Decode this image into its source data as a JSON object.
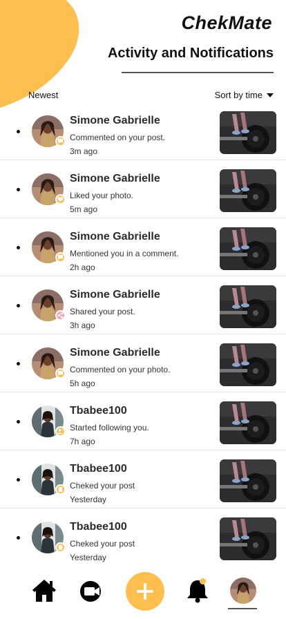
{
  "header": {
    "app_title": "ChekMate",
    "page_title": "Activity and Notifications"
  },
  "filter": {
    "label": "Newest",
    "sort_label": "Sort by time"
  },
  "colors": {
    "accent": "#fdbf50",
    "badge_pink": "#f5a3b8"
  },
  "notifications": [
    {
      "user": "Simone Gabrielle",
      "message": "Commented on your post.",
      "time": "3m ago",
      "badge_icon": "comment-icon",
      "avatar": "simone"
    },
    {
      "user": "Simone Gabrielle",
      "message": "Liked your photo.",
      "time": "5m ago",
      "badge_icon": "heart-icon",
      "avatar": "simone"
    },
    {
      "user": "Simone Gabrielle",
      "message": "Mentioned you in a comment.",
      "time": "2h ago",
      "badge_icon": "comment-icon",
      "avatar": "simone"
    },
    {
      "user": "Simone Gabrielle",
      "message": "Shared your post.",
      "time": "3h ago",
      "badge_icon": "share-icon",
      "avatar": "simone"
    },
    {
      "user": "Simone Gabrielle",
      "message": "Commented on your photo.",
      "time": "5h ago",
      "badge_icon": "comment-icon",
      "avatar": "simone"
    },
    {
      "user": "Tbabee100",
      "message": "Started following you.",
      "time": "7h ago",
      "badge_icon": "follow-icon",
      "avatar": "tbabee"
    },
    {
      "user": "Tbabee100",
      "message": "Cheked your post",
      "time": "Yesterday",
      "badge_icon": "flag-icon",
      "avatar": "tbabee"
    },
    {
      "user": "Tbabee100",
      "message": "Cheked your post",
      "time": "Yesterday",
      "badge_icon": "flag-icon",
      "avatar": "tbabee"
    }
  ],
  "bottom_nav": {
    "items": [
      "home-icon",
      "camera-icon",
      "plus-icon",
      "bell-icon",
      "profile-avatar"
    ],
    "active": "profile-avatar"
  }
}
